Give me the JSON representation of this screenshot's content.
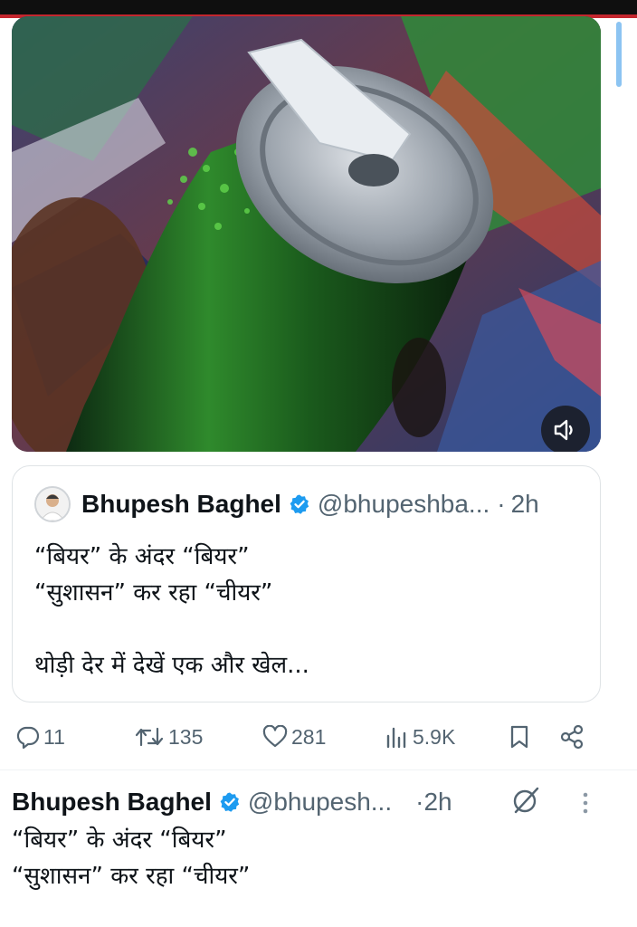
{
  "media": {
    "description_icon": "speaker-icon"
  },
  "quoted_tweet": {
    "name": "Bhupesh Baghel",
    "handle": "@bhupeshba...",
    "separator": "·",
    "time": "2h",
    "lines": [
      "“बियर” के अंदर “बियर”",
      "“सुशासन” कर रहा “चीयर”",
      "",
      "थोड़ी देर में देखें एक और खेल..."
    ]
  },
  "actions": {
    "replies": "11",
    "reposts": "135",
    "likes": "281",
    "views": "5.9K"
  },
  "next_tweet": {
    "name": "Bhupesh Baghel",
    "handle": "@bhupesh...",
    "time": "·2h",
    "lines": [
      "“बियर” के अंदर “बियर”",
      "“सुशासन” कर रहा “चीयर”"
    ]
  },
  "colors": {
    "accent": "#1d9bf0",
    "muted": "#536471",
    "text": "#0f1419"
  }
}
